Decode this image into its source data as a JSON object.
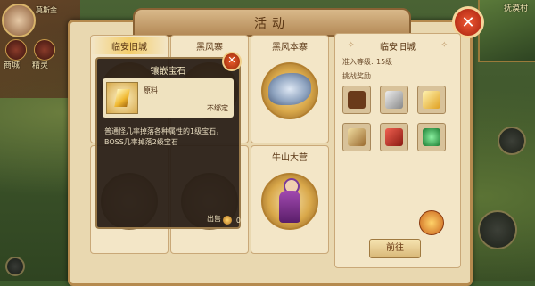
{
  "hud": {
    "player_name": "莫斯金",
    "left_labels": [
      "商城",
      "精灵"
    ],
    "minimap_title": "抚漠村"
  },
  "window": {
    "title": "活动",
    "close_symbol": "✕"
  },
  "cards": [
    {
      "title": "临安旧城",
      "selected": true
    },
    {
      "title": "黑风寨",
      "selected": false
    },
    {
      "title": "黑风本寨",
      "selected": false
    },
    {
      "title": "",
      "selected": false
    },
    {
      "title": "",
      "selected": false
    },
    {
      "title": "牛山大营",
      "selected": false
    }
  ],
  "detail": {
    "title": "临安旧城",
    "level_label": "准入等级:",
    "level_value": "15级",
    "reward_label": "挑战奖励",
    "rewards": [
      {
        "name": "armor-icon",
        "color": "#6a3a1a"
      },
      {
        "name": "silver-ingot-icon",
        "color": "#b0b0b0"
      },
      {
        "name": "gold-gem-icon",
        "color": "#e8b830"
      },
      {
        "name": "scroll-icon",
        "color": "#c9a060"
      },
      {
        "name": "red-scroll-icon",
        "color": "#c0302a"
      },
      {
        "name": "green-jade-icon",
        "color": "#2aa84a"
      }
    ],
    "go_button": "前往"
  },
  "tooltip": {
    "title": "镶嵌宝石",
    "type": "原料",
    "bind": "不绑定",
    "description": "普通怪几率掉落各种属性的1级宝石，BOSS几率掉落2级宝石",
    "sell_label": "出售",
    "sell_value": "0"
  }
}
